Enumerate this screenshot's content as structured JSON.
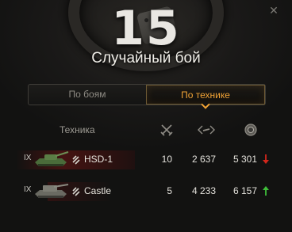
{
  "battle_count": "15",
  "mode_title": "Случайный бой",
  "tabs": [
    {
      "label": "По боям",
      "active": false
    },
    {
      "label": "По технике",
      "active": true
    }
  ],
  "columns": {
    "vehicle": "Техника",
    "battles_icon": "crossed-swords-icon",
    "damage_icon": "damage-arrows-icon",
    "xp_icon": "medal-icon"
  },
  "rows": [
    {
      "tier": "IX",
      "name": "HSD-1",
      "battles": "10",
      "damage": "2 637",
      "xp": "5 301",
      "trend": "down",
      "trend_color": "#d3261b"
    },
    {
      "tier": "IX",
      "name": "Castle",
      "battles": "5",
      "damage": "4 233",
      "xp": "6 157",
      "trend": "up",
      "trend_color": "#3fbf3a"
    }
  ],
  "colors": {
    "accent": "#f0a235",
    "highlight_row": "#6e1412"
  }
}
